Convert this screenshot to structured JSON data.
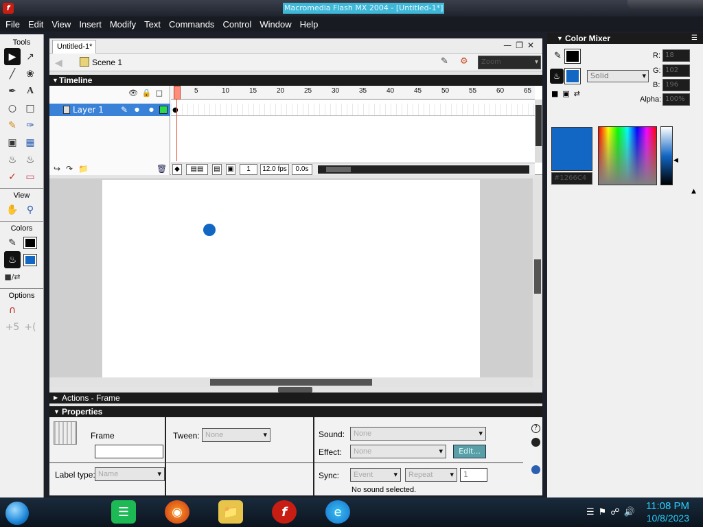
{
  "window": {
    "title": "Macromedia Flash MX 2004 - [Untitled-1*]"
  },
  "menu": [
    "File",
    "Edit",
    "View",
    "Insert",
    "Modify",
    "Text",
    "Commands",
    "Control",
    "Window",
    "Help"
  ],
  "tools": {
    "header": "Tools",
    "view_header": "View",
    "colors_header": "Colors",
    "options_header": "Options"
  },
  "document": {
    "tab": "Untitled-1*",
    "scene": "Scene 1",
    "zoom": "Zoom"
  },
  "timeline": {
    "header": "Timeline",
    "layer_name": "Layer 1",
    "ruler_ticks": [
      "1",
      "5",
      "10",
      "15",
      "20",
      "25",
      "30",
      "35",
      "40",
      "45",
      "50",
      "55",
      "60",
      "65"
    ],
    "current_frame": "1",
    "fps": "12.0 fps",
    "elapsed": "0.0s"
  },
  "panels": {
    "actions": "Actions - Frame",
    "properties": "Properties"
  },
  "properties": {
    "frame_label": "Frame",
    "frame_name": "",
    "tween_label": "Tween:",
    "tween_value": "None",
    "sound_label": "Sound:",
    "sound_value": "None",
    "effect_label": "Effect:",
    "effect_value": "None",
    "edit_button": "Edit...",
    "label_type_label": "Label type:",
    "label_type_value": "Name",
    "sync_label": "Sync:",
    "sync_value": "Event",
    "repeat_value": "Repeat",
    "repeat_count": "1",
    "sound_status": "No sound selected."
  },
  "color_mixer": {
    "header": "Color Mixer",
    "fill_type": "Solid",
    "r_label": "R:",
    "r_value": "18",
    "g_label": "G:",
    "g_value": "102",
    "b_label": "B:",
    "b_value": "196",
    "alpha_label": "Alpha:",
    "alpha_value": "100%",
    "hex": "#1266C4",
    "fill_color": "#1266c4"
  },
  "taskbar": {
    "time": "11:08 PM",
    "date": "10/8/2023"
  }
}
